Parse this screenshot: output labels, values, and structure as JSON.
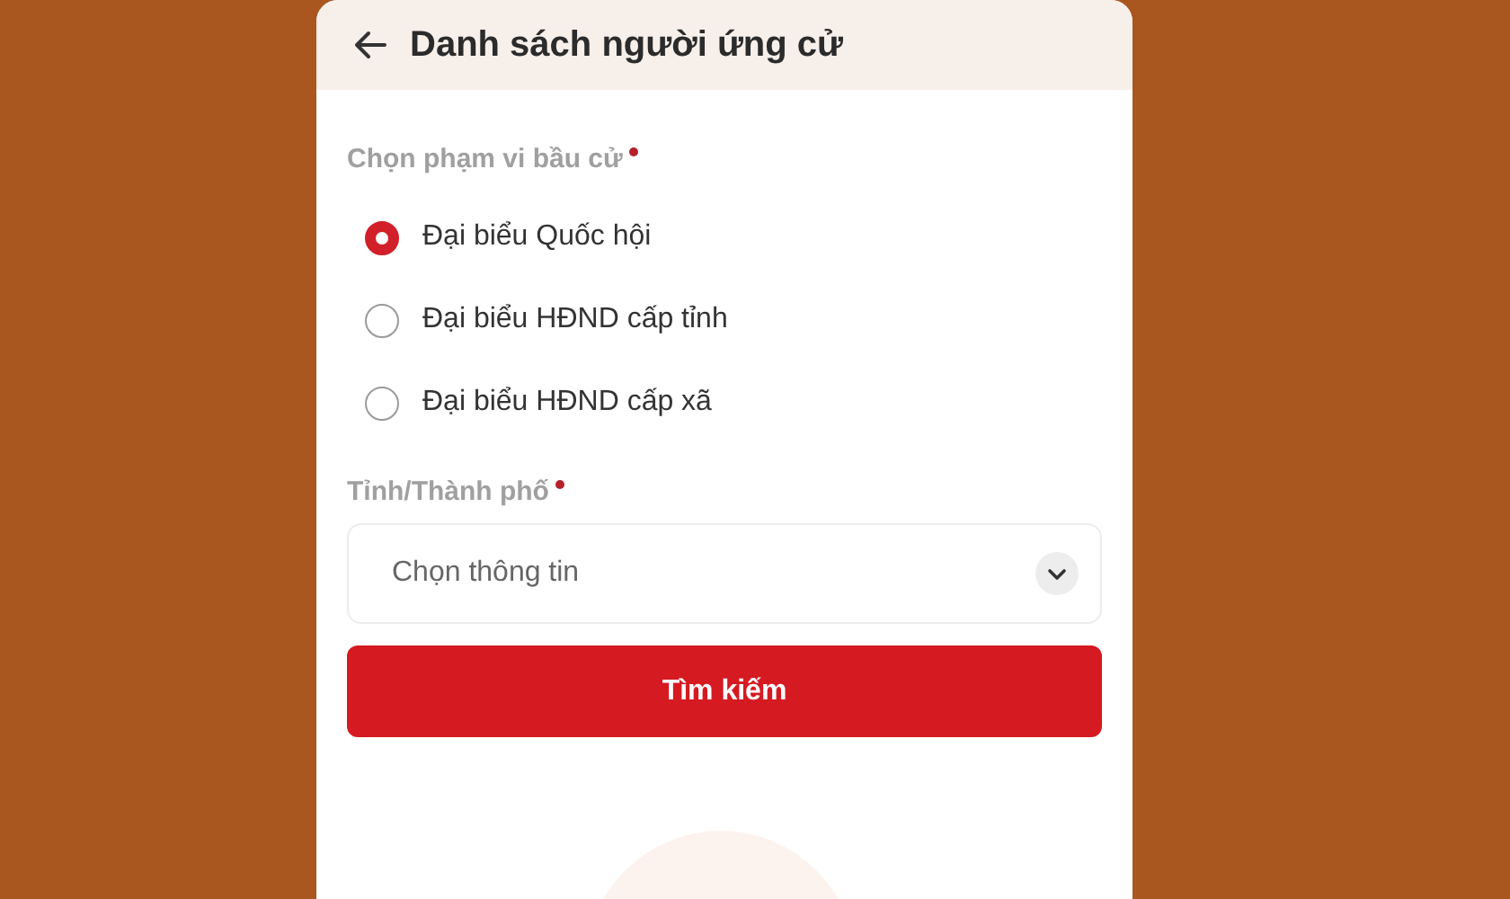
{
  "header": {
    "title": "Danh sách người ứng cử"
  },
  "scope": {
    "label": "Chọn phạm vi bầu cử",
    "required": true,
    "options": [
      {
        "label": "Đại biểu Quốc hội",
        "selected": true
      },
      {
        "label": "Đại biểu HĐND cấp tỉnh",
        "selected": false
      },
      {
        "label": "Đại biểu HĐND cấp xã",
        "selected": false
      }
    ]
  },
  "province": {
    "label": "Tỉnh/Thành phố",
    "required": true,
    "placeholder": "Chọn thông tin"
  },
  "search_button": {
    "label": "Tìm kiếm"
  }
}
